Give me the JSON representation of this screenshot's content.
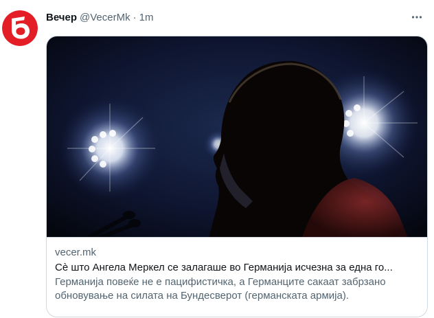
{
  "tweet": {
    "display_name": "Вечер",
    "handle": "@VecerMk",
    "separator": "·",
    "time_ago": "1m"
  },
  "card": {
    "domain": "vecer.mk",
    "title": "Сè што Ангела Меркел се залагаше во Германија исчезна за една го...",
    "description": "Германија повеќе не е пацифистичка, а Германците сакаат забрзано обновување на силата на Бундесверот (германската армија)."
  },
  "icons": {
    "avatar": "vecer-logo",
    "more": "more-horizontal-icon"
  },
  "colors": {
    "logo_red": "#e41e26",
    "text_primary": "#0f1419",
    "text_secondary": "#536471",
    "border": "#cfd9de"
  }
}
